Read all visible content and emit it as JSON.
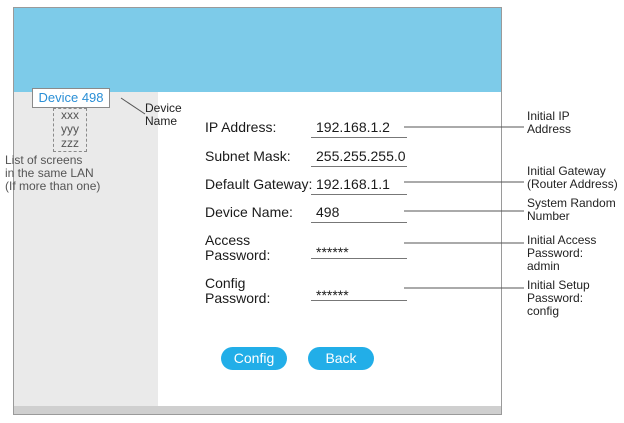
{
  "sidebar": {
    "device_button": "Device 498",
    "device_list": [
      "xxx",
      "yyy",
      "zzz"
    ],
    "note_lines": [
      "List of screens",
      "in the same LAN",
      "(If more than one)"
    ]
  },
  "device_name_callout": [
    "Device",
    "Name"
  ],
  "form": {
    "ip_label": "IP Address:",
    "ip_value": "192.168.1.2",
    "mask_label": "Subnet Mask:",
    "mask_value": "255.255.255.0",
    "gateway_label": "Default Gateway:",
    "gateway_value": "192.168.1.1",
    "name_label": "Device Name:",
    "name_value": "498",
    "access_label": [
      "Access",
      "Password:"
    ],
    "access_value": "******",
    "config_label": [
      "Config",
      "Password:"
    ],
    "config_value": "******"
  },
  "buttons": {
    "config": "Config",
    "back": "Back"
  },
  "callouts": {
    "ip": [
      "Initial IP",
      "Address"
    ],
    "gateway": [
      "Initial Gateway",
      "(Router Address)"
    ],
    "name": [
      "System Random",
      "Number"
    ],
    "access": [
      "Initial Access",
      "Password:",
      "admin"
    ],
    "config": [
      "Initial Setup",
      "Password:",
      "config"
    ]
  }
}
